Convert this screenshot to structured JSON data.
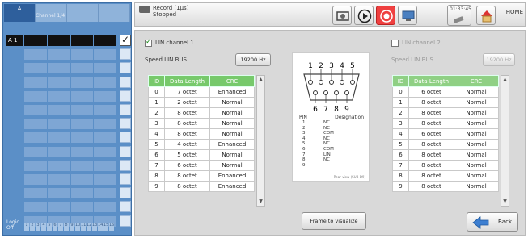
{
  "left_panel": {
    "tabs": [
      {
        "label": "A"
      },
      {
        "label": ""
      },
      {
        "label": ""
      },
      {
        "label": ""
      }
    ],
    "tab_subtitle": "Channel 1/4",
    "channels": [
      {
        "label": "A 1",
        "selected": true,
        "checked": true
      },
      {
        "label": "",
        "selected": false,
        "checked": false
      },
      {
        "label": "",
        "selected": false,
        "checked": false
      },
      {
        "label": "",
        "selected": false,
        "checked": false
      },
      {
        "label": "",
        "selected": false,
        "checked": false
      },
      {
        "label": "",
        "selected": false,
        "checked": false
      },
      {
        "label": "",
        "selected": false,
        "checked": false
      },
      {
        "label": "",
        "selected": false,
        "checked": false
      },
      {
        "label": "",
        "selected": false,
        "checked": false
      },
      {
        "label": "",
        "selected": false,
        "checked": false
      },
      {
        "label": "",
        "selected": false,
        "checked": false
      },
      {
        "label": "",
        "selected": false,
        "checked": false
      },
      {
        "label": "",
        "selected": false,
        "checked": false
      },
      {
        "label": "",
        "selected": false,
        "checked": false
      }
    ],
    "logic_label_1": "Logic",
    "logic_label_2": "Off",
    "logic_bits": [
      "1",
      "2",
      "3",
      "4",
      "5",
      "6",
      "7",
      "8",
      "9",
      "10",
      "11",
      "12",
      "13",
      "14",
      "15",
      "16"
    ]
  },
  "topbar": {
    "record_line1": "Record (1µs)",
    "record_line2": "Stopped",
    "time": "01:33:45",
    "home_label": "HOME"
  },
  "lin1": {
    "checkbox_label": "LIN channel 1",
    "checked": true,
    "speed_label": "Speed LIN BUS",
    "speed_value": "19200 Hz",
    "headers": [
      "ID",
      "Data Length",
      "CRC"
    ],
    "rows": [
      [
        "0",
        "7 octet",
        "Enhanced"
      ],
      [
        "1",
        "2 octet",
        "Normal"
      ],
      [
        "2",
        "8 octet",
        "Normal"
      ],
      [
        "3",
        "8 octet",
        "Normal"
      ],
      [
        "4",
        "8 octet",
        "Normal"
      ],
      [
        "5",
        "4 octet",
        "Enhanced"
      ],
      [
        "6",
        "5 octet",
        "Normal"
      ],
      [
        "7",
        "6 octet",
        "Normal"
      ],
      [
        "8",
        "8 octet",
        "Enhanced"
      ],
      [
        "9",
        "8 octet",
        "Enhanced"
      ]
    ]
  },
  "lin2": {
    "checkbox_label": "LIN channel 2",
    "checked": false,
    "speed_label": "Speed LIN BUS",
    "speed_value": "19200 Hz",
    "headers": [
      "ID",
      "Data Length",
      "CRC"
    ],
    "rows": [
      [
        "0",
        "6 octet",
        "Normal"
      ],
      [
        "1",
        "8 octet",
        "Normal"
      ],
      [
        "2",
        "8 octet",
        "Normal"
      ],
      [
        "3",
        "8 octet",
        "Normal"
      ],
      [
        "4",
        "6 octet",
        "Normal"
      ],
      [
        "5",
        "8 octet",
        "Normal"
      ],
      [
        "6",
        "8 octet",
        "Normal"
      ],
      [
        "7",
        "8 octet",
        "Normal"
      ],
      [
        "8",
        "8 octet",
        "Normal"
      ],
      [
        "9",
        "8 octet",
        "Normal"
      ]
    ]
  },
  "pinout": {
    "top_numbers": [
      "1",
      "2",
      "3",
      "4",
      "5"
    ],
    "bottom_numbers": [
      "6",
      "7",
      "8",
      "9"
    ],
    "col_pin": "PIN",
    "col_designation": "Designation",
    "rows": [
      [
        "1",
        "NC"
      ],
      [
        "2",
        "NC"
      ],
      [
        "3",
        "COM"
      ],
      [
        "4",
        "NC"
      ],
      [
        "5",
        "NC"
      ],
      [
        "6",
        "COM"
      ],
      [
        "7",
        "LIN"
      ],
      [
        "8",
        "NC"
      ],
      [
        "9",
        ""
      ]
    ],
    "note": "Rear view (SUB-D9)"
  },
  "footer": {
    "frame_button": "Frame to visualize",
    "back_button": "Back"
  },
  "colors": {
    "left_panel": "#5b8fc7",
    "table_header": "#77c96b",
    "record_button": "#ef4040"
  }
}
